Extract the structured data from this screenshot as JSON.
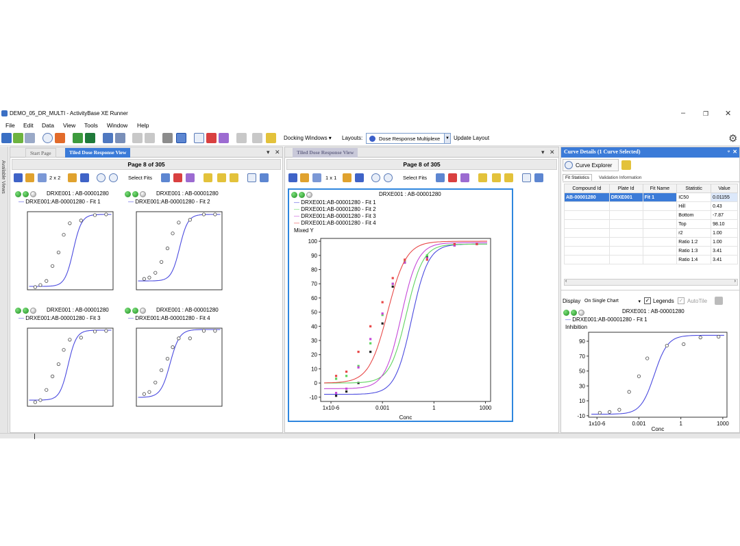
{
  "window": {
    "title": "DEMO_05_DR_MULTI - ActivityBase XE Runner"
  },
  "menu": [
    "File",
    "Edit",
    "Data",
    "View",
    "Tools",
    "Window",
    "Help"
  ],
  "toolbar": {
    "docking_windows": "Docking Windows",
    "layouts_label": "Layouts:",
    "layout_value": "Dose Response Multiplexe",
    "update_layout": "Update Layout"
  },
  "side": {
    "available_views": "Available Views"
  },
  "colors": {
    "accent": "#3b7bd8",
    "fit1": "#4a4adf",
    "fit2": "#5fd45f",
    "fit3": "#c548d8",
    "fit4": "#e84848"
  },
  "left_pane": {
    "tab_start": "Start Page",
    "tab_active": "Tiled Dose Response View",
    "page_header": "Page 8 of 305",
    "grid_label": "2 x 2",
    "select_fits": "Select Fits",
    "tiles": [
      {
        "title": "DRXE001 : AB-00001280",
        "fit": "DRXE001:AB-00001280 - Fit 1"
      },
      {
        "title": "DRXE001 : AB-00001280",
        "fit": "DRXE001:AB-00001280 - Fit 2"
      },
      {
        "title": "DRXE001 : AB-00001280",
        "fit": "DRXE001:AB-00001280 - Fit 3"
      },
      {
        "title": "DRXE001 : AB-00001280",
        "fit": "DRXE001:AB-00001280 - Fit 4"
      }
    ]
  },
  "mid_pane": {
    "tab": "Tiled Dose Response View",
    "page_header": "Page 8 of 305",
    "grid_label": "1 x 1",
    "select_fits": "Select Fits",
    "title": "DRXE001 : AB-00001280",
    "legend": [
      "DRXE001:AB-00001280 - Fit 1",
      "DRXE001:AB-00001280 - Fit 2",
      "DRXE001:AB-00001280 - Fit 3",
      "DRXE001:AB-00001280 - Fit 4"
    ],
    "ylabel": "Mixed Y",
    "xlabel": "Conc"
  },
  "right_pane": {
    "title": "Curve Details (1 Curve Selected)",
    "curve_explorer": "Curve Explorer",
    "tabs": [
      "Fit Statistics",
      "Validation Information"
    ],
    "columns": [
      "Compound Id",
      "Plate Id",
      "Fit Name",
      "Statistic",
      "Value"
    ],
    "selected": {
      "compound": "AB-00001280",
      "plate": "DRXE001",
      "fit": "Fit 1"
    },
    "stats": [
      {
        "name": "IC50",
        "value": "0.01155"
      },
      {
        "name": "Hill",
        "value": "0.43"
      },
      {
        "name": "Bottom",
        "value": "-7.87"
      },
      {
        "name": "Top",
        "value": "98.10"
      },
      {
        "name": "r2",
        "value": "1.00"
      },
      {
        "name": "Ratio 1:2",
        "value": "1.00"
      },
      {
        "name": "Ratio 1:3",
        "value": "3.41"
      },
      {
        "name": "Ratio 1:4",
        "value": "3.41"
      }
    ],
    "display_label": "Display",
    "display_value": "On Single Chart",
    "legends_label": "Legends",
    "autotile_label": "AutoTile",
    "chart_title": "DRXE001 : AB-00001280",
    "chart_fit": "DRXE001:AB-00001280 - Fit 1",
    "ylabel": "Inhibition",
    "xlabel": "Conc"
  },
  "chart_data": [
    {
      "type": "scatter",
      "title": "DRXE001 : AB-00001280",
      "xlabel": "Conc",
      "ylabel": "Mixed Y",
      "x_scale": "log",
      "x_ticks": [
        "1x10-6",
        "0.001",
        "1",
        "1000"
      ],
      "y_ticks": [
        -10,
        0,
        10,
        20,
        30,
        40,
        50,
        60,
        70,
        80,
        90,
        100
      ],
      "ylim": [
        -13,
        102
      ],
      "xlim_log10": [
        -6.6,
        3.3
      ],
      "series": [
        {
          "name": "DRXE001:AB-00001280 - Fit 1",
          "color": "#4a4adf",
          "logIC50": -1.3,
          "hill": 0.9,
          "bottom": -8,
          "top": 98,
          "points": [
            [
              -5.7,
              -9
            ],
            [
              -5.1,
              -6
            ],
            [
              -4.4,
              0
            ],
            [
              -3.7,
              22
            ],
            [
              -3.0,
              42
            ],
            [
              -2.4,
              68
            ],
            [
              -1.7,
              85
            ],
            [
              -0.4,
              89
            ],
            [
              1.2,
              97
            ],
            [
              2.5,
              98
            ]
          ]
        },
        {
          "name": "DRXE001:AB-00001280 - Fit 2",
          "color": "#5fd45f",
          "logIC50": -1.6,
          "hill": 0.9,
          "bottom": 0,
          "top": 98,
          "points": [
            [
              -5.7,
              3
            ],
            [
              -5.1,
              5
            ],
            [
              -4.4,
              12
            ],
            [
              -3.7,
              28
            ],
            [
              -3.0,
              48
            ],
            [
              -2.4,
              70
            ],
            [
              -1.7,
              86
            ],
            [
              -0.4,
              90
            ],
            [
              1.2,
              98
            ],
            [
              2.5,
              98
            ]
          ]
        },
        {
          "name": "DRXE001:AB-00001280 - Fit 3",
          "color": "#c548d8",
          "logIC50": -1.9,
          "hill": 0.9,
          "bottom": -4,
          "top": 99,
          "points": [
            [
              -5.7,
              -7
            ],
            [
              -5.1,
              -4
            ],
            [
              -4.4,
              11
            ],
            [
              -3.7,
              31
            ],
            [
              -3.0,
              49
            ],
            [
              -2.4,
              70
            ],
            [
              -1.7,
              85
            ],
            [
              -0.4,
              88
            ],
            [
              1.2,
              97
            ],
            [
              2.5,
              98
            ]
          ]
        },
        {
          "name": "DRXE001:AB-00001280 - Fit 4",
          "color": "#e84848",
          "logIC50": -2.7,
          "hill": 0.8,
          "bottom": 0,
          "top": 100,
          "points": [
            [
              -5.7,
              5
            ],
            [
              -5.1,
              8
            ],
            [
              -4.4,
              22
            ],
            [
              -3.7,
              40
            ],
            [
              -3.0,
              57
            ],
            [
              -2.4,
              74
            ],
            [
              -1.7,
              87
            ],
            [
              -0.4,
              87
            ],
            [
              1.2,
              98
            ],
            [
              2.5,
              98
            ]
          ]
        }
      ]
    },
    {
      "type": "scatter",
      "title": "DRXE001 : AB-00001280",
      "xlabel": "Conc",
      "ylabel": "Inhibition",
      "x_scale": "log",
      "x_ticks": [
        "1x10-6",
        "0.001",
        "1",
        "1000"
      ],
      "y_ticks": [
        -10,
        10,
        30,
        50,
        70,
        90
      ],
      "ylim": [
        -12,
        102
      ],
      "xlim_log10": [
        -6.6,
        3.3
      ],
      "series": [
        {
          "name": "DRXE001:AB-00001280 - Fit 1",
          "color": "#4a4adf",
          "logIC50": -1.9,
          "hill": 0.9,
          "bottom": -8,
          "top": 98,
          "points": [
            [
              -5.8,
              -6
            ],
            [
              -5.1,
              -5
            ],
            [
              -4.4,
              -2
            ],
            [
              -3.7,
              22
            ],
            [
              -3.0,
              43
            ],
            [
              -2.4,
              67
            ],
            [
              -1.0,
              84
            ],
            [
              0.2,
              86
            ],
            [
              1.4,
              95
            ],
            [
              2.7,
              96
            ]
          ]
        }
      ]
    }
  ]
}
